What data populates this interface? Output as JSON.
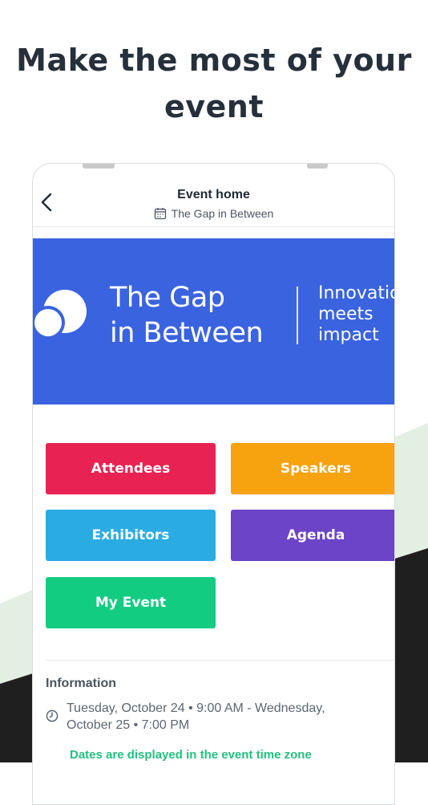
{
  "headline": "Make the most of your event",
  "header": {
    "title": "Event home",
    "subtitle": "The Gap in Between",
    "back_icon": "chevron-left-icon",
    "subtitle_icon": "calendar-icon"
  },
  "banner": {
    "name_line1": "The Gap",
    "name_line2": "in Between",
    "tagline_line1": "Innovation",
    "tagline_line2": "meets",
    "tagline_line3": "impact",
    "background": "#3a63e0"
  },
  "tiles": [
    {
      "label": "Attendees",
      "color": "#e82252"
    },
    {
      "label": "Speakers",
      "color": "#f7a20f"
    },
    {
      "label": "Exhibitors",
      "color": "#2aace3"
    },
    {
      "label": "Agenda",
      "color": "#6b44c7"
    },
    {
      "label": "My Event",
      "color": "#12cc82"
    }
  ],
  "info": {
    "heading": "Information",
    "dates_line1": "Tuesday, October 24 • 9:00 AM - Wednesday,",
    "dates_line2": "October 25 • 7:00 PM",
    "timezone_note": "Dates are displayed in the event time zone",
    "clock_icon": "clock-icon",
    "note_color": "#22c07f"
  },
  "colors": {
    "headline": "#25303b",
    "backdrop_green": "#e4efe3",
    "backdrop_dark": "#1f1f1f"
  }
}
